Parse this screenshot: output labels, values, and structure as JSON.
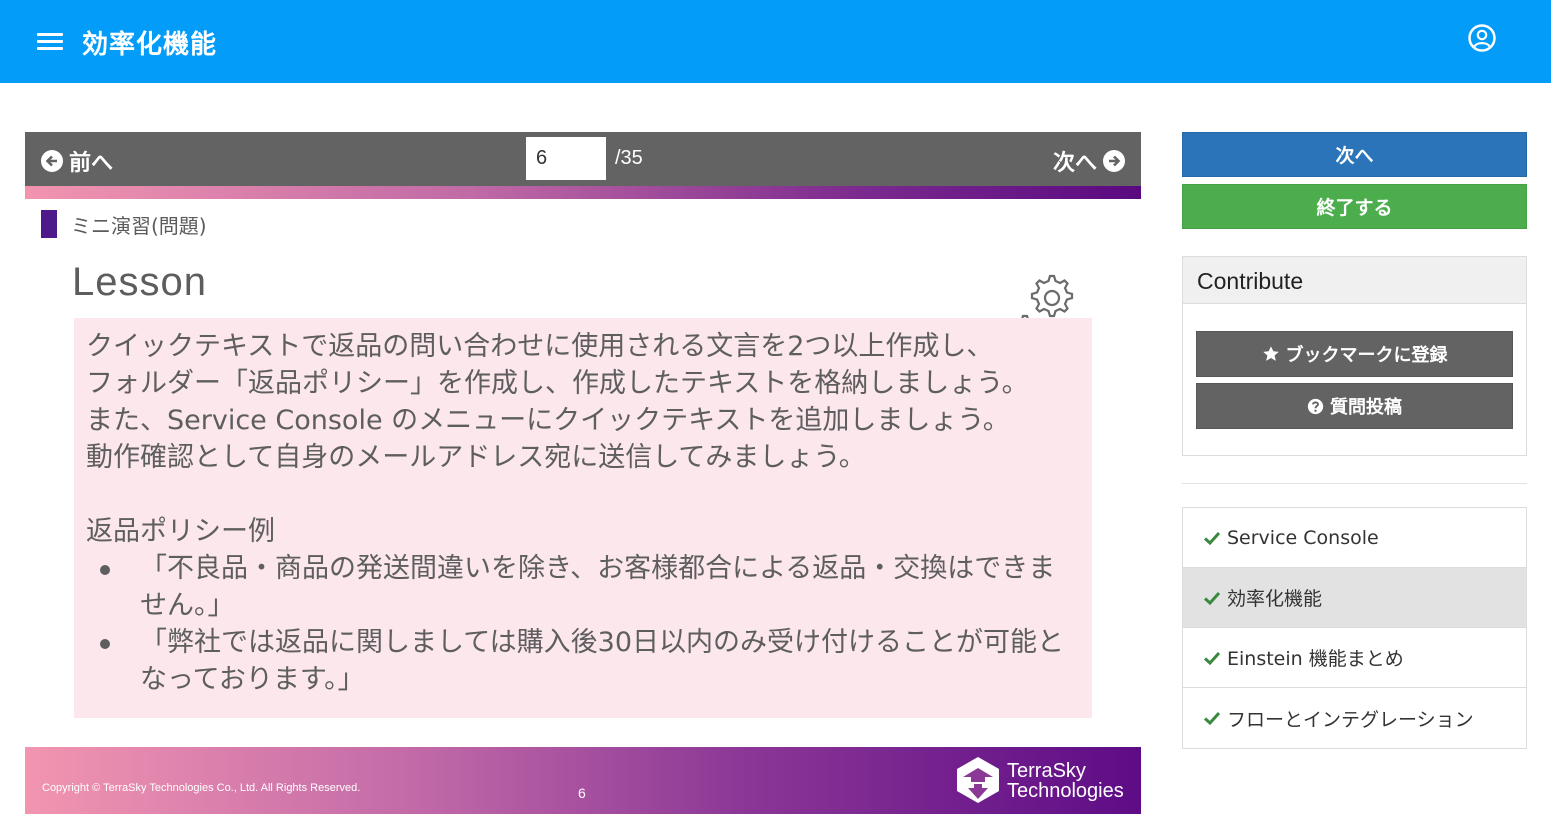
{
  "header": {
    "title": "効率化機能",
    "menu_icon": "hamburger-icon",
    "account_icon": "user-circle-icon",
    "background": "#039cf9"
  },
  "viewer": {
    "prev_label": "前へ",
    "next_label": "次へ",
    "current_page": "6",
    "total_pages": "/35"
  },
  "slide": {
    "section_label": "ミニ演習(問題)",
    "title": "Lesson",
    "paragraphs": [
      "クイックテキストで返品の問い合わせに使用される文言を2つ以上作成し、",
      "フォルダー「返品ポリシー」を作成し、作成したテキストを格納しましょう。",
      "また、Service Console のメニューにクイックテキストを追加しましょう。",
      "動作確認として自身のメールアドレス宛に送信してみましょう。"
    ],
    "example_heading": "返品ポリシー例",
    "bullets": [
      "「不良品・商品の発送間違いを除き、お客様都合による返品・交換はできません。」",
      "「弊社では返品に関しましては購入後30日以内のみ受け付けることが可能となっております。」"
    ],
    "copyright": "Copyright © TerraSky Technologies Co., Ltd. All Rights Reserved.",
    "page_number": "6",
    "logo_line1": "TerraSky",
    "logo_line2": "Technologies"
  },
  "sidebar": {
    "next_button": "次へ",
    "finish_button": "終了する",
    "contribute_title": "Contribute",
    "bookmark_button": "ブックマークに登録",
    "question_button": "質問投稿",
    "chapters": [
      {
        "label": "Service Console",
        "active": false
      },
      {
        "label": "効率化機能",
        "active": true
      },
      {
        "label": "Einstein 機能まとめ",
        "active": false
      },
      {
        "label": "フローとインテグレーション",
        "active": false
      }
    ],
    "colors": {
      "next": "#2b74b9",
      "finish": "#4cad4d",
      "check": "#3a8a3e"
    }
  }
}
